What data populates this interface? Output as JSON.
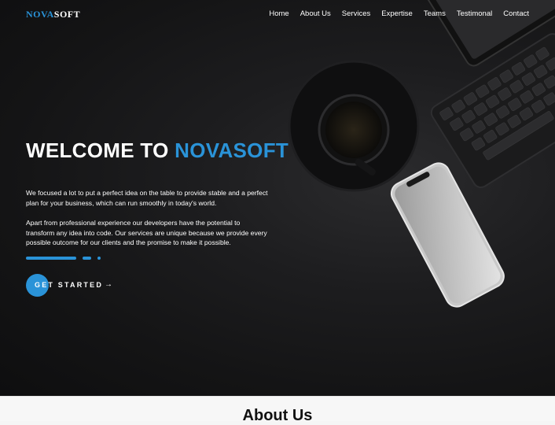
{
  "brand": {
    "part1": "NOVA",
    "part2": "SOFT"
  },
  "nav": {
    "items": [
      {
        "label": "Home"
      },
      {
        "label": "About Us"
      },
      {
        "label": "Services"
      },
      {
        "label": "Expertise"
      },
      {
        "label": "Teams"
      },
      {
        "label": "Testimonal"
      },
      {
        "label": "Contact"
      }
    ]
  },
  "hero": {
    "title_prefix": "WELCOME TO",
    "title_accent": "NOVASOFT",
    "paragraph1": "We focused a lot to put a perfect idea on the table to provide stable and a perfect plan for your business, which can run smoothly in today's world.",
    "paragraph2": "Apart from professional experience our developers have the potential to transform any idea into code. Our services are unique because we provide every possible outcome for our clients and the promise to make it possible.",
    "cta_label": "GET STARTED",
    "cta_icon": "arrow-right-icon"
  },
  "about": {
    "heading": "About Us"
  },
  "colors": {
    "accent": "#2a93d8",
    "hero_background": "#161617",
    "text": "#ffffff"
  }
}
